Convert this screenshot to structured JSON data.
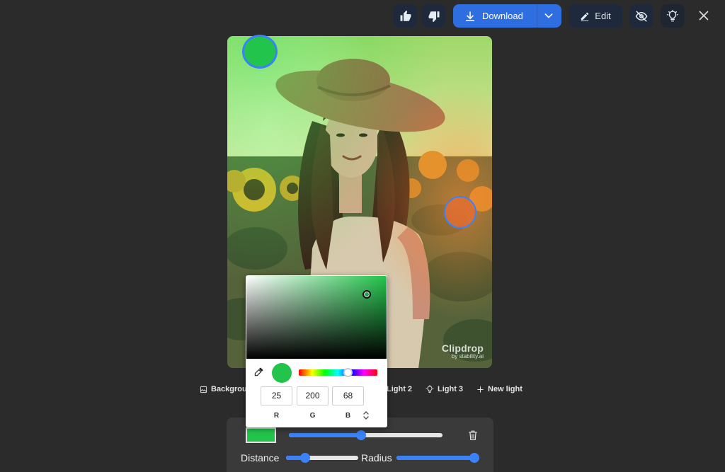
{
  "toolbar": {
    "download_label": "Download",
    "edit_label": "Edit",
    "icons": [
      "thumbs-up-icon",
      "thumbs-down-icon",
      "download-icon",
      "chevron-down-icon",
      "edit-icon",
      "eye-off-icon",
      "light-bulb-icon",
      "close-icon"
    ]
  },
  "image": {
    "watermark_title": "Clipdrop",
    "watermark_sub": "by stability.ai"
  },
  "tabs": [
    {
      "label": "Background",
      "icon": "image-icon"
    },
    {
      "label": "Light 2",
      "icon": "light-bulb-icon"
    },
    {
      "label": "Light 3",
      "icon": "light-bulb-icon"
    },
    {
      "label": "New light",
      "icon": "plus-icon"
    }
  ],
  "color_picker": {
    "hex_color": "#22c44b",
    "channels": [
      {
        "label": "R",
        "value": "25"
      },
      {
        "label": "G",
        "value": "200"
      },
      {
        "label": "B",
        "value": "68"
      }
    ],
    "hue_fraction": 0.62
  },
  "light_panel": {
    "swatch_color": "#22c44b",
    "intensity_fraction": 0.47,
    "distance_label": "Distance",
    "distance_fraction": 0.26,
    "radius_label": "Radius",
    "radius_fraction": 1.0
  },
  "colors": {
    "accent": "#3b82f6",
    "download_bg": "#2f6ee0",
    "background": "#2b2b2b",
    "green_light": "#22c44b"
  }
}
